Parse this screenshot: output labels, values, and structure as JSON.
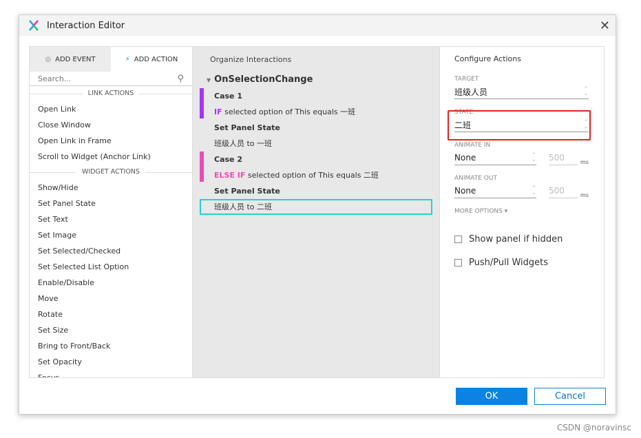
{
  "window": {
    "title": "Interaction Editor"
  },
  "left": {
    "tabs": [
      {
        "label": "ADD EVENT",
        "icon": "cursor-click-icon"
      },
      {
        "label": "ADD ACTION",
        "icon": "lightning-plus-icon"
      }
    ],
    "search_placeholder": "Search...",
    "link_section": "LINK ACTIONS",
    "link_items": [
      "Open Link",
      "Close Window",
      "Open Link in Frame",
      "Scroll to Widget (Anchor Link)"
    ],
    "widget_section": "WIDGET ACTIONS",
    "widget_items": [
      "Show/Hide",
      "Set Panel State",
      "Set Text",
      "Set Image",
      "Set Selected/Checked",
      "Set Selected List Option",
      "Enable/Disable",
      "Move",
      "Rotate",
      "Set Size",
      "Bring to Front/Back",
      "Set Opacity",
      "Focus"
    ]
  },
  "middle": {
    "header": "Organize Interactions",
    "event": "OnSelectionChange",
    "cases": [
      {
        "name": "Case 1",
        "keyword": "IF",
        "condition": "selected option of This equals 一班",
        "color": "#a536f5",
        "action": "Set Panel State",
        "detail": "班级人员 to 一班"
      },
      {
        "name": "Case 2",
        "keyword": "ELSE IF",
        "condition": "selected option of This equals 二班",
        "color": "#e94db4",
        "action": "Set Panel State",
        "detail": "班级人员 to 二班"
      }
    ]
  },
  "right": {
    "header": "Configure Actions",
    "target_label": "TARGET",
    "target_value": "班级人员",
    "state_label": "STATE",
    "state_value": "二班",
    "animate_in_label": "ANIMATE IN",
    "animate_in_value": "None",
    "animate_in_ms": "500",
    "animate_out_label": "ANIMATE OUT",
    "animate_out_value": "None",
    "animate_out_ms": "500",
    "ms_unit": "ms",
    "more_options": "MORE OPTIONS ▾",
    "checkboxes": [
      {
        "label": "Show panel if hidden",
        "checked": false
      },
      {
        "label": "Push/Pull Widgets",
        "checked": false
      }
    ]
  },
  "footer": {
    "ok": "OK",
    "cancel": "Cancel"
  },
  "watermark": "CSDN @noravinsc",
  "colors": {
    "accent": "#0a84e0",
    "highlight": "#e52020",
    "selected": "#20d3d3"
  }
}
